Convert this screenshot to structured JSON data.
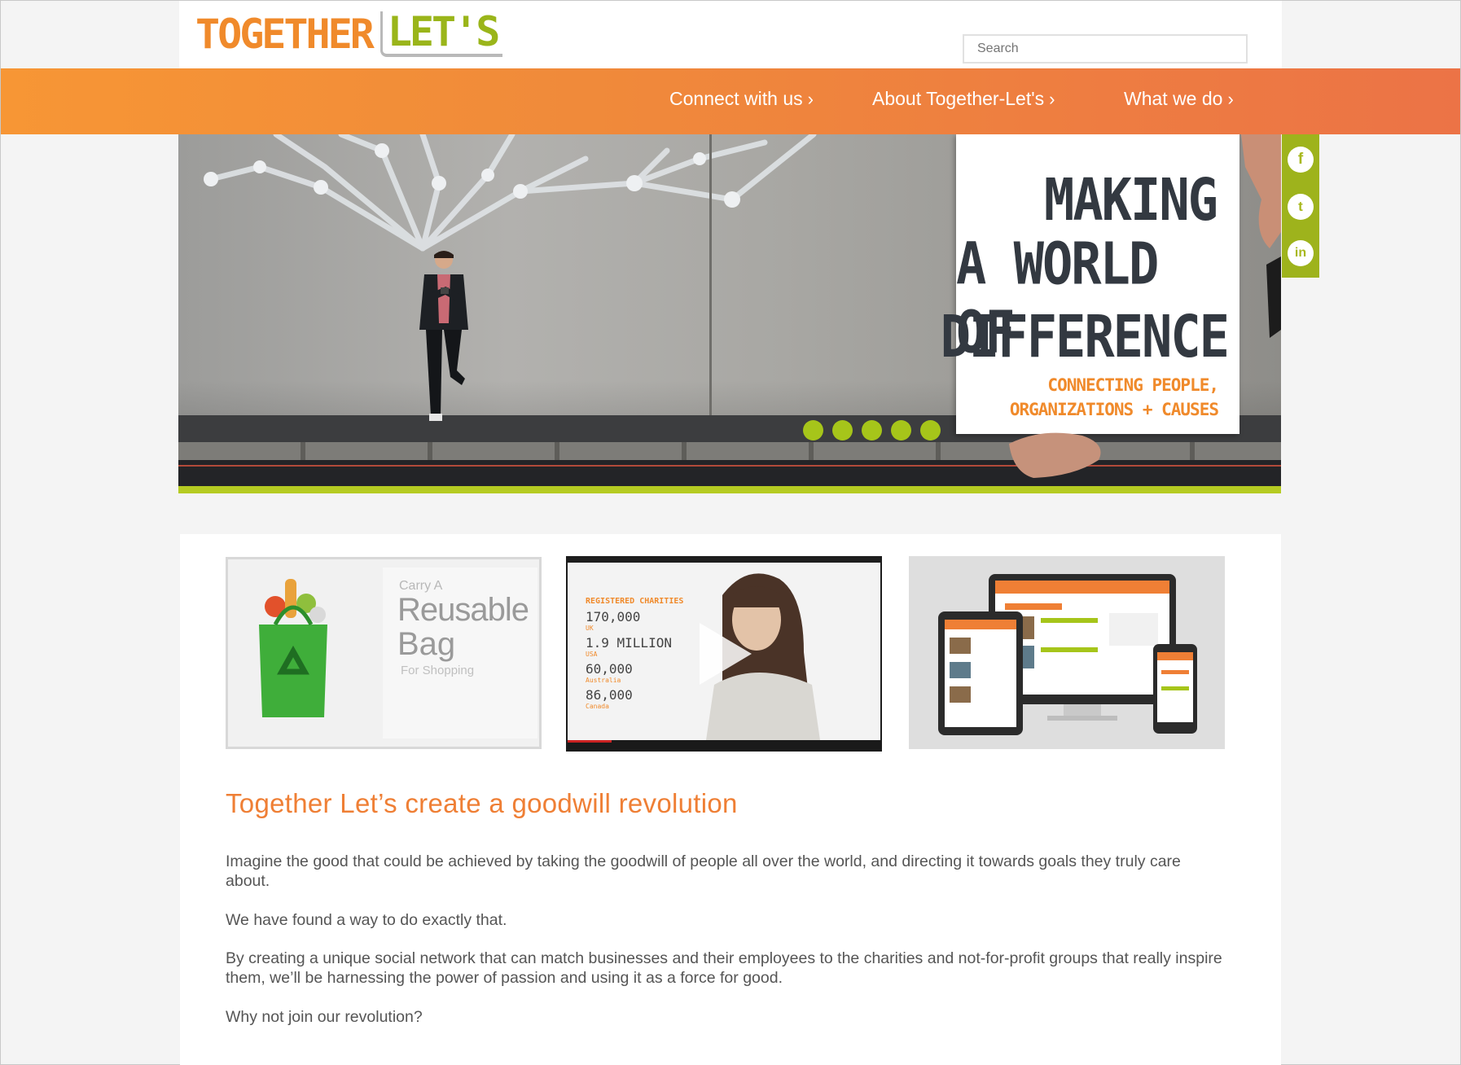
{
  "logo": {
    "word1": "TOGETHER",
    "word2": "LET'S"
  },
  "search": {
    "placeholder": "Search"
  },
  "nav": {
    "items": [
      {
        "label": "Connect with us"
      },
      {
        "label": "About Together-Let's"
      },
      {
        "label": "What we do"
      }
    ],
    "chevron": "›"
  },
  "hero": {
    "line1": "MAKING",
    "line2": "A WORLD OF",
    "line3": "DIFFERENCE",
    "sub1": "CONNECTING PEOPLE,",
    "sub2": "ORGANIZATIONS + CAUSES",
    "slide_count": 5
  },
  "social": [
    {
      "icon": "facebook-icon",
      "glyph": "f"
    },
    {
      "icon": "twitter-icon",
      "glyph": "t"
    },
    {
      "icon": "linkedin-icon",
      "glyph": "in"
    }
  ],
  "tiles": {
    "bag": {
      "small": "Carry A",
      "big1": "Reusable",
      "big2": "Bag",
      "sub": "For Shopping"
    },
    "video": {
      "header": "REGISTERED CHARITIES",
      "stats": [
        {
          "value": "170,000",
          "label": "UK"
        },
        {
          "value": "1.9 MILLION",
          "label": "USA"
        },
        {
          "value": "60,000",
          "label": "Australia"
        },
        {
          "value": "86,000",
          "label": "Canada"
        }
      ]
    }
  },
  "main": {
    "heading": "Together Let’s create a goodwill revolution",
    "p1": "Imagine the good that could be achieved by taking the goodwill of people all over the world, and directing it towards goals they truly care about.",
    "p2": "We have found a way to do exactly that.",
    "p3": "By creating a unique social network that can match businesses and their employees to the charities and not-for-profit groups that really inspire them, we’ll be harnessing the power of passion and using it as a force for good.",
    "p4": "Why not join our revolution?"
  },
  "colors": {
    "orange": "#ef7f35",
    "green": "#a6c51a",
    "text": "#555555"
  }
}
